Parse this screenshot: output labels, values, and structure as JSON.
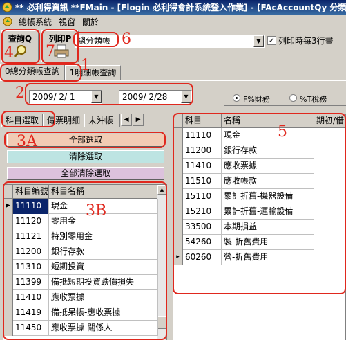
{
  "window": {
    "title": "** 必利得資訊 **FMain - [Flogin 必利得會計系統登入作業] - [FAcAccountQy 分類帳"
  },
  "menu": {
    "items": [
      "總帳系統",
      "視窗",
      "關於"
    ]
  },
  "toolbar": {
    "query_label": "查詢Q",
    "print_label": "列印P",
    "report_select_value": "總分類帳",
    "print_every_3_checked": true,
    "print_every_3_label": "列印時每3行畫"
  },
  "tabs": [
    "0總分類帳查詢",
    "1明細帳查詢"
  ],
  "date_range": {
    "from": "2009/ 2/ 1",
    "to": "2009/ 2/28"
  },
  "radio": {
    "options": [
      "F%財務",
      "%T稅務"
    ],
    "selected": "F%財務"
  },
  "subtabs": [
    "科目選取",
    "傳票明細",
    "未沖帳"
  ],
  "buttons": {
    "select_all": "全部選取",
    "clear_select": "清除選取",
    "clear_all": "全部清除選取"
  },
  "colors": {
    "select_all_bg": "#f2cbb4",
    "clear_select_bg": "#bde4e2",
    "clear_all_bg": "#dcc2dc",
    "annotation": "#e0281e"
  },
  "left_grid": {
    "headers": [
      "科目編號",
      "科目名稱"
    ],
    "rows": [
      [
        "11110",
        "現金"
      ],
      [
        "11120",
        "零用金"
      ],
      [
        "11121",
        "特別零用金"
      ],
      [
        "11200",
        "銀行存款"
      ],
      [
        "11310",
        "短期投資"
      ],
      [
        "11399",
        "備抵短期投資跌價損失"
      ],
      [
        "11410",
        "應收票據"
      ],
      [
        "11419",
        "備抵呆帳-應收票據"
      ],
      [
        "11450",
        "應收票據-關係人"
      ]
    ],
    "selected_index": 0
  },
  "right_grid": {
    "headers": [
      "科目",
      "名稱",
      "期初/借"
    ],
    "rows": [
      [
        "11110",
        "現金"
      ],
      [
        "11200",
        "銀行存款"
      ],
      [
        "11410",
        "應收票據"
      ],
      [
        "11510",
        "應收帳款"
      ],
      [
        "15110",
        "累計折舊-機器設備"
      ],
      [
        "15210",
        "累計折舊-運輸設備"
      ],
      [
        "33500",
        "本期損益"
      ],
      [
        "54260",
        "製-折舊費用"
      ],
      [
        "60260",
        "營-折舊費用"
      ]
    ],
    "current_index": 8
  },
  "annotations": [
    "1",
    "2",
    "3A",
    "3B",
    "4",
    "5",
    "6",
    "7"
  ]
}
